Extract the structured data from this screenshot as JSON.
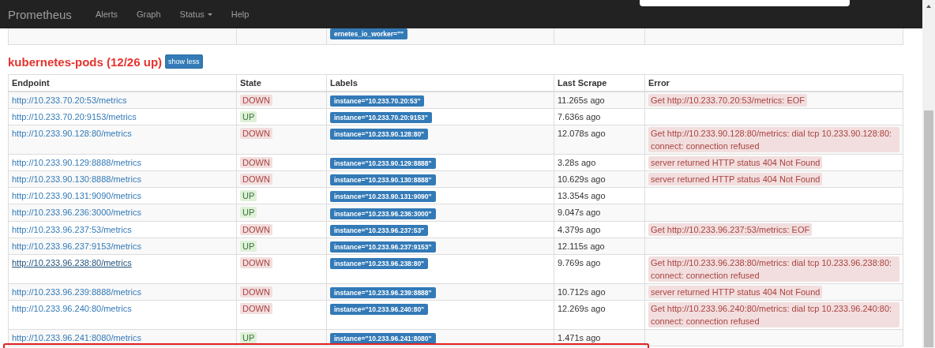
{
  "navbar": {
    "brand": "Prometheus",
    "items": [
      {
        "label": "Alerts",
        "dropdown": false
      },
      {
        "label": "Graph",
        "dropdown": false
      },
      {
        "label": "Status",
        "dropdown": true
      },
      {
        "label": "Help",
        "dropdown": false
      }
    ]
  },
  "previous_table_row": {
    "labels": [
      "ernetes_io_worker=\"\""
    ]
  },
  "section": {
    "title": "kubernetes-pods (12/26 up)",
    "toggle": "show less"
  },
  "table": {
    "columns": [
      "Endpoint",
      "State",
      "Labels",
      "Last Scrape",
      "Error"
    ],
    "rows": [
      {
        "endpoint": "http://10.233.70.20:53/metrics",
        "hovered": false,
        "state": "DOWN",
        "up": false,
        "labels": [
          "instance=\"10.233.70.20:53\""
        ],
        "last_scrape": "11.265s ago",
        "error": "Get http://10.233.70.20:53/metrics: EOF"
      },
      {
        "endpoint": "http://10.233.70.20:9153/metrics",
        "hovered": false,
        "state": "UP",
        "up": true,
        "labels": [
          "instance=\"10.233.70.20:9153\""
        ],
        "last_scrape": "7.636s ago"
      },
      {
        "endpoint": "http://10.233.90.128:80/metrics",
        "hovered": false,
        "state": "DOWN",
        "up": false,
        "labels": [
          "instance=\"10.233.90.128:80\""
        ],
        "last_scrape": "12.078s ago",
        "error": "Get http://10.233.90.128:80/metrics: dial tcp 10.233.90.128:80: connect: connection refused"
      },
      {
        "endpoint": "http://10.233.90.129:8888/metrics",
        "hovered": false,
        "state": "DOWN",
        "up": false,
        "labels": [
          "instance=\"10.233.90.129:8888\""
        ],
        "last_scrape": "3.28s ago",
        "error": "server returned HTTP status 404 Not Found"
      },
      {
        "endpoint": "http://10.233.90.130:8888/metrics",
        "hovered": false,
        "state": "DOWN",
        "up": false,
        "labels": [
          "instance=\"10.233.90.130:8888\""
        ],
        "last_scrape": "10.629s ago",
        "error": "server returned HTTP status 404 Not Found"
      },
      {
        "endpoint": "http://10.233.90.131:9090/metrics",
        "hovered": false,
        "state": "UP",
        "up": true,
        "labels": [
          "instance=\"10.233.90.131:9090\""
        ],
        "last_scrape": "13.354s ago"
      },
      {
        "endpoint": "http://10.233.96.236:3000/metrics",
        "hovered": false,
        "state": "UP",
        "up": true,
        "labels": [
          "instance=\"10.233.96.236:3000\""
        ],
        "last_scrape": "9.047s ago"
      },
      {
        "endpoint": "http://10.233.96.237:53/metrics",
        "hovered": false,
        "state": "DOWN",
        "up": false,
        "labels": [
          "instance=\"10.233.96.237:53\""
        ],
        "last_scrape": "4.379s ago",
        "error": "Get http://10.233.96.237:53/metrics: EOF"
      },
      {
        "endpoint": "http://10.233.96.237:9153/metrics",
        "hovered": false,
        "state": "UP",
        "up": true,
        "labels": [
          "instance=\"10.233.96.237:9153\""
        ],
        "last_scrape": "12.115s ago"
      },
      {
        "endpoint": "http://10.233.96.238:80/metrics",
        "hovered": true,
        "state": "DOWN",
        "up": false,
        "labels": [
          "instance=\"10.233.96.238:80\""
        ],
        "last_scrape": "9.769s ago",
        "error": "Get http://10.233.96.238:80/metrics: dial tcp 10.233.96.238:80: connect: connection refused"
      },
      {
        "endpoint": "http://10.233.96.239:8888/metrics",
        "hovered": false,
        "state": "DOWN",
        "up": false,
        "labels": [
          "instance=\"10.233.96.239:8888\""
        ],
        "last_scrape": "10.712s ago",
        "error": "server returned HTTP status 404 Not Found"
      },
      {
        "endpoint": "http://10.233.96.240:80/metrics",
        "hovered": false,
        "state": "DOWN",
        "up": false,
        "labels": [
          "instance=\"10.233.96.240:80\""
        ],
        "last_scrape": "12.269s ago",
        "error": "Get http://10.233.96.240:80/metrics: dial tcp 10.233.96.240:80: connect: connection refused"
      },
      {
        "endpoint": "http://10.233.96.241:8080/metrics",
        "hovered": false,
        "state": "UP",
        "up": true,
        "labels": [
          "instance=\"10.233.96.241:8080\""
        ],
        "last_scrape": "1.471s ago"
      }
    ]
  }
}
